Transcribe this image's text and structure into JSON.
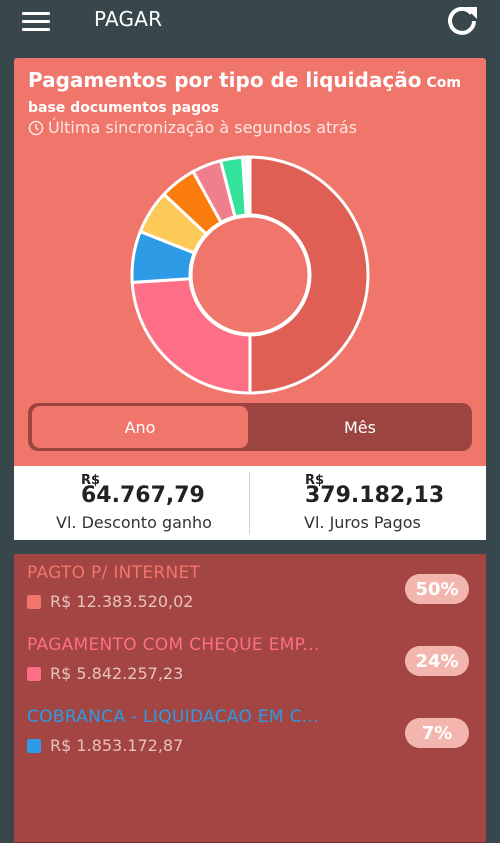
{
  "header": {
    "title": "PAGAR",
    "menu_icon": "hamburger-menu-icon",
    "refresh_icon": "refresh-icon"
  },
  "card": {
    "title": "Pagamentos por tipo de liquidação",
    "subtitle": "Com base documentos pagos",
    "sync_text": "Última sincronização à segundos atrás",
    "background_color": "#f0766b"
  },
  "chart_data": {
    "type": "pie",
    "donut": true,
    "title": "",
    "slices": [
      {
        "value": 50,
        "color": "#e05f55"
      },
      {
        "value": 24,
        "color": "#fe6e86"
      },
      {
        "value": 7,
        "color": "#2d9be5"
      },
      {
        "value": 6,
        "color": "#fdca57"
      },
      {
        "value": 5,
        "color": "#fb7d0d"
      },
      {
        "value": 4,
        "color": "#f07f8e"
      },
      {
        "value": 3,
        "color": "#34e39b"
      },
      {
        "value": 0.6,
        "color": "#e9f2f4"
      },
      {
        "value": 0.4,
        "color": "#f0756b"
      }
    ]
  },
  "toggle": {
    "options": [
      "Ano",
      "Mês"
    ],
    "selected": "Ano"
  },
  "stats": [
    {
      "currency": "R$",
      "value": "64.767,79",
      "label": "Vl. Desconto ganho"
    },
    {
      "currency": "R$",
      "value": "379.182,13",
      "label": "Vl. Juros Pagos"
    }
  ],
  "list": [
    {
      "name": "PAGTO P/ INTERNET",
      "amount": "R$ 12.383.520,02",
      "percent": "50%",
      "color": "#f0766b"
    },
    {
      "name": "PAGAMENTO COM CHEQUE EMP...",
      "amount": "R$ 5.842.257,23",
      "percent": "24%",
      "color": "#fe6e86"
    },
    {
      "name": "COBRANCA - LIQUIDACAO EM C...",
      "amount": "R$ 1.853.172,87",
      "percent": "7%",
      "color": "#2d9be5"
    }
  ]
}
